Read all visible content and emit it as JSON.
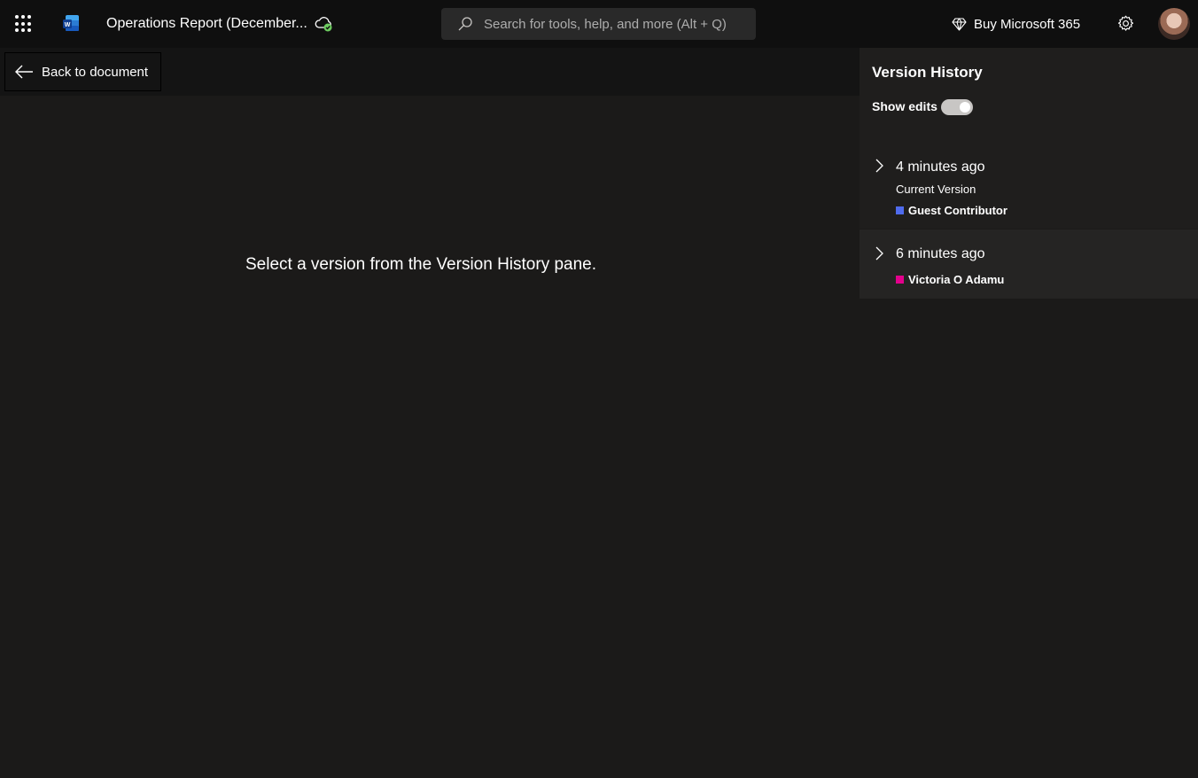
{
  "app": {
    "doc_title": "Operations Report (December...",
    "search_placeholder": "Search for tools, help, and more (Alt + Q)",
    "buy_label": "Buy Microsoft 365"
  },
  "subbar": {
    "back_label": "Back to document"
  },
  "main": {
    "message": "Select a version from the Version History pane."
  },
  "version_pane": {
    "title": "Version History",
    "show_edits_label": "Show edits",
    "show_edits_on": true,
    "versions": [
      {
        "time": "4 minutes ago",
        "subtitle": "Current Version",
        "author": "Guest Contributor",
        "author_color": "#4f6bed"
      },
      {
        "time": "6 minutes ago",
        "author": "Victoria O Adamu",
        "author_color": "#e3008c"
      }
    ]
  },
  "icons": [
    "waffle-icon",
    "word-icon",
    "cloud-saved-icon",
    "search-icon",
    "diamond-icon",
    "gear-icon",
    "back-arrow-icon",
    "chevron-right-icon"
  ]
}
